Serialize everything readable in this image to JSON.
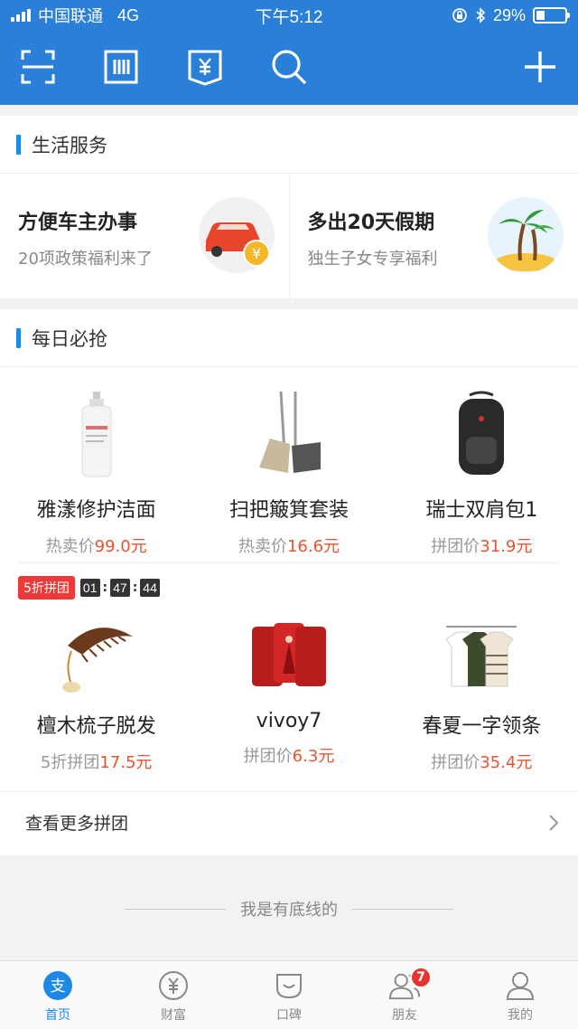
{
  "status_bar": {
    "carrier": "中国联通",
    "network": "4G",
    "time": "下午5:12",
    "battery": "29%",
    "battery_level": 0.29
  },
  "toolbar": {
    "icons": [
      "scan-icon",
      "barcode-pay-icon",
      "wallet-icon",
      "search-icon",
      "add-icon"
    ]
  },
  "life_services": {
    "title": "生活服务",
    "items": [
      {
        "title": "方便车主办事",
        "subtitle": "20项政策福利来了",
        "icon": "car-icon"
      },
      {
        "title": "多出20天假期",
        "subtitle": "独生子女专享福利",
        "icon": "palm-tree-icon"
      }
    ]
  },
  "daily_deals": {
    "title": "每日必抢",
    "row1": [
      {
        "name": "雅漾修护洁面",
        "price_label": "热卖价",
        "price": "99.0元"
      },
      {
        "name": "扫把簸箕套装",
        "price_label": "热卖价",
        "price": "16.6元"
      },
      {
        "name": "瑞士双肩包1",
        "price_label": "拼团价",
        "price": "31.9元"
      }
    ],
    "promo_tag": "5折拼团",
    "countdown": {
      "h": "01",
      "m": "47",
      "s": "44"
    },
    "row2": [
      {
        "name": "檀木梳子脱发",
        "price_label": "5折拼团",
        "price": "17.5元"
      },
      {
        "name": "vivoy7",
        "price_label": "拼团价",
        "price": "6.3元"
      },
      {
        "name": "春夏一字领条",
        "price_label": "拼团价",
        "price": "35.4元"
      }
    ],
    "more_label": "查看更多拼团"
  },
  "footer_note": "我是有底线的",
  "tabbar": {
    "tabs": [
      {
        "label": "首页",
        "active": true
      },
      {
        "label": "财富"
      },
      {
        "label": "口碑"
      },
      {
        "label": "朋友",
        "badge": "7"
      },
      {
        "label": "我的"
      }
    ]
  },
  "colors": {
    "brand_blue": "#2a7fd8",
    "price_red": "#e8542f",
    "badge_red": "#e8332f"
  }
}
